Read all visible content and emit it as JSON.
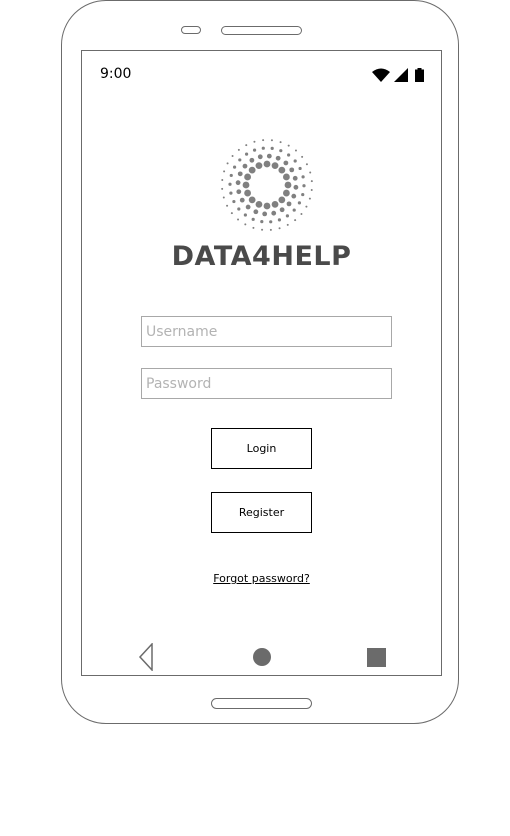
{
  "status_bar": {
    "time": "9:00",
    "icons": [
      "wifi-icon",
      "signal-icon",
      "battery-icon"
    ]
  },
  "app": {
    "brand": "DATA4HELP",
    "logo": "sunburst-dots-logo"
  },
  "login_form": {
    "username_placeholder": "Username",
    "username_value": "",
    "password_placeholder": "Password",
    "password_value": "",
    "login_label": "Login",
    "register_label": "Register",
    "forgot_label": "Forgot password?"
  },
  "nav_bar": {
    "back": "back-triangle-icon",
    "home": "home-circle-icon",
    "recents": "recents-square-icon"
  },
  "colors": {
    "frame": "#6b6b6b",
    "brand_text": "#4a4a4a",
    "logo_dots": "#808080",
    "input_border": "#a8a8a8"
  }
}
